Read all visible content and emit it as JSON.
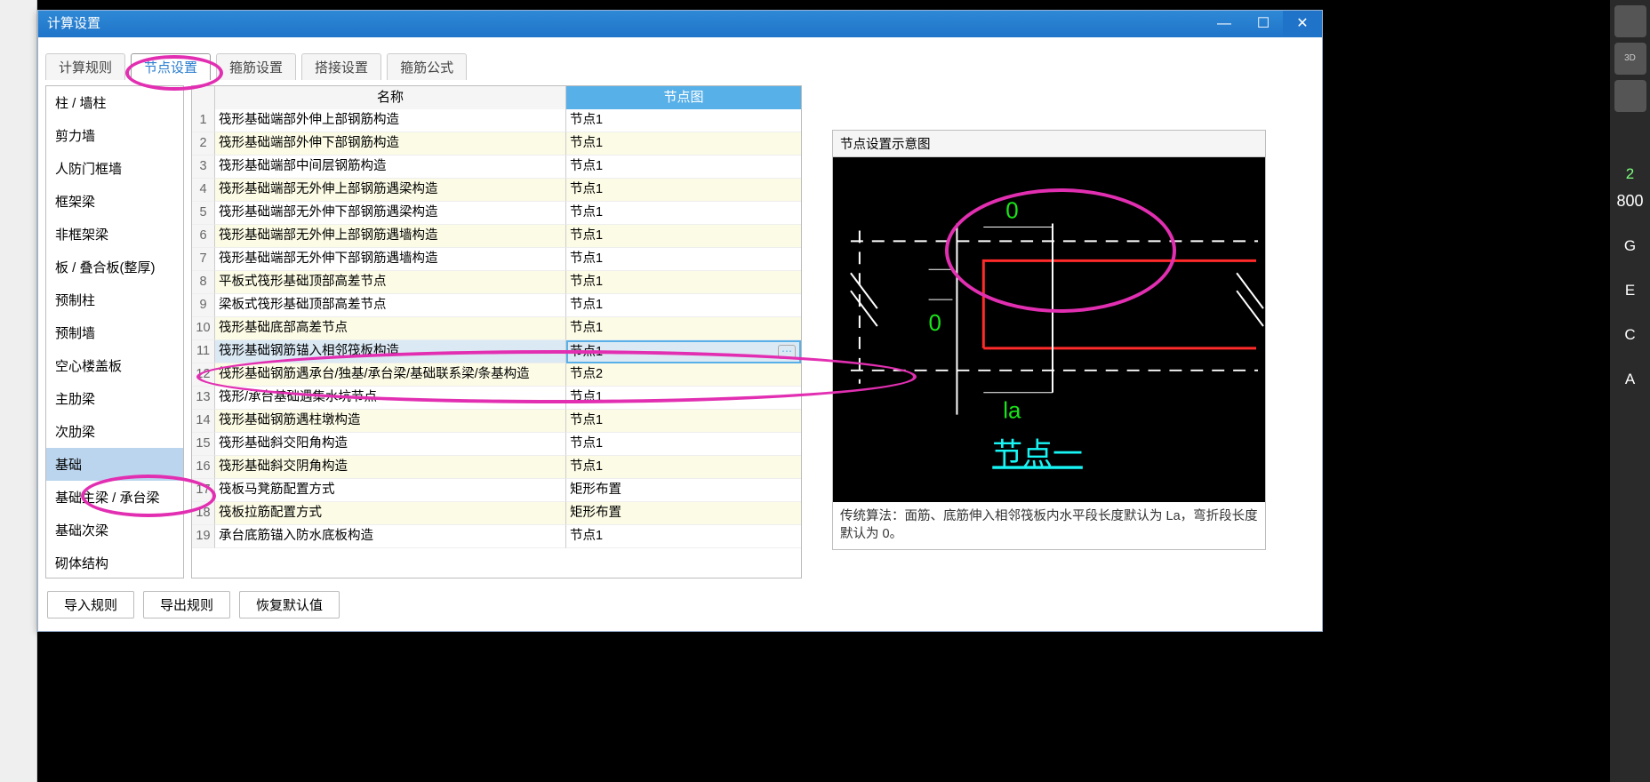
{
  "dialog": {
    "title": "计算设置"
  },
  "tabs": [
    "计算规则",
    "节点设置",
    "箍筋设置",
    "搭接设置",
    "箍筋公式"
  ],
  "tabs_active_index": 1,
  "sidebar": {
    "items": [
      "柱 / 墙柱",
      "剪力墙",
      "人防门框墙",
      "框架梁",
      "非框架梁",
      "板 / 叠合板(整厚)",
      "预制柱",
      "预制墙",
      "空心楼盖板",
      "主肋梁",
      "次肋梁",
      "基础",
      "基础主梁 / 承台梁",
      "基础次梁",
      "砌体结构"
    ],
    "active_index": 11
  },
  "table": {
    "headers": {
      "name": "名称",
      "node": "节点图"
    },
    "rows": [
      {
        "i": 1,
        "name": "筏形基础端部外伸上部钢筋构造",
        "node": "节点1"
      },
      {
        "i": 2,
        "name": "筏形基础端部外伸下部钢筋构造",
        "node": "节点1"
      },
      {
        "i": 3,
        "name": "筏形基础端部中间层钢筋构造",
        "node": "节点1"
      },
      {
        "i": 4,
        "name": "筏形基础端部无外伸上部钢筋遇梁构造",
        "node": "节点1"
      },
      {
        "i": 5,
        "name": "筏形基础端部无外伸下部钢筋遇梁构造",
        "node": "节点1"
      },
      {
        "i": 6,
        "name": "筏形基础端部无外伸上部钢筋遇墙构造",
        "node": "节点1"
      },
      {
        "i": 7,
        "name": "筏形基础端部无外伸下部钢筋遇墙构造",
        "node": "节点1"
      },
      {
        "i": 8,
        "name": "平板式筏形基础顶部高差节点",
        "node": "节点1"
      },
      {
        "i": 9,
        "name": "梁板式筏形基础顶部高差节点",
        "node": "节点1"
      },
      {
        "i": 10,
        "name": "筏形基础底部高差节点",
        "node": "节点1"
      },
      {
        "i": 11,
        "name": "筏形基础钢筋锚入相邻筏板构造",
        "node": "节点1"
      },
      {
        "i": 12,
        "name": "筏形基础钢筋遇承台/独基/承台梁/基础联系梁/条基构造",
        "node": "节点2"
      },
      {
        "i": 13,
        "name": "筏形/承台基础遇集水坑节点",
        "node": "节点1"
      },
      {
        "i": 14,
        "name": "筏形基础钢筋遇柱墩构造",
        "node": "节点1"
      },
      {
        "i": 15,
        "name": "筏形基础斜交阳角构造",
        "node": "节点1"
      },
      {
        "i": 16,
        "name": "筏形基础斜交阴角构造",
        "node": "节点1"
      },
      {
        "i": 17,
        "name": "筏板马凳筋配置方式",
        "node": "矩形布置"
      },
      {
        "i": 18,
        "name": "筏板拉筋配置方式",
        "node": "矩形布置"
      },
      {
        "i": 19,
        "name": "承台底筋锚入防水底板构造",
        "node": "节点1"
      }
    ],
    "selected_index": 10
  },
  "preview": {
    "title": "节点设置示意图",
    "diagram": {
      "top_label": "0",
      "mid_label": "0",
      "bottom_label": "la",
      "caption": "节点一"
    },
    "note": "传统算法：面筋、底筋伸入相邻筏板内水平段长度默认为 La，弯折段长度默认为 0。"
  },
  "footer": {
    "import": "导入规则",
    "export": "导出规则",
    "reset": "恢复默认值"
  },
  "right_letters": [
    "2",
    "G",
    "E",
    "C",
    "A"
  ]
}
